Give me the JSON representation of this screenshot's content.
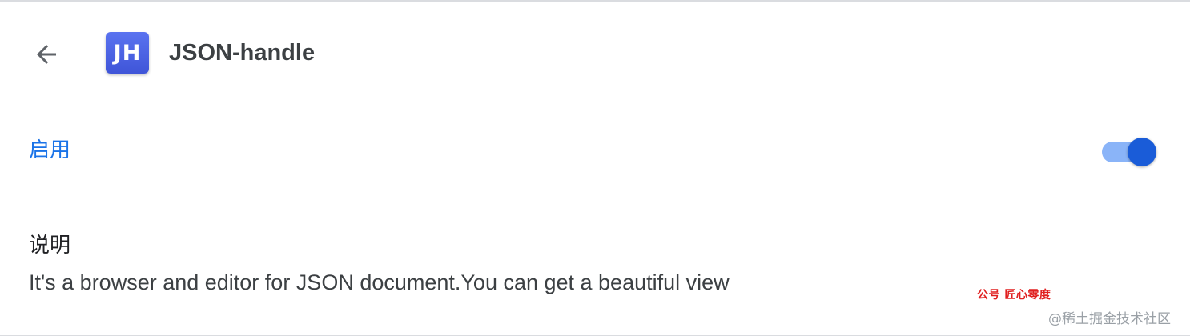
{
  "header": {
    "back_icon": "arrow-back-icon",
    "extension_icon_text": "JH",
    "extension_icon_color": "#4a63e6",
    "title": "JSON-handle"
  },
  "enable": {
    "label": "启用",
    "toggle_on": true,
    "accent_color": "#1a73e8"
  },
  "description": {
    "heading": "说明",
    "text": "It's a browser and editor for JSON document.You can get a beautiful view"
  },
  "watermarks": {
    "red_text": "公号  匠心零度",
    "gray_text": "@稀土掘金技术社区"
  }
}
